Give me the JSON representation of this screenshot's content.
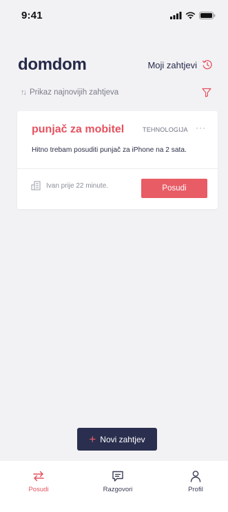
{
  "status_bar": {
    "time": "9:41"
  },
  "header": {
    "logo": "domdom",
    "my_requests_label": "Moji zahtjevi"
  },
  "sort": {
    "label": "Prikaz najnovijih zahtjeva",
    "arrows": "↑↓"
  },
  "requests": [
    {
      "title": "punjač za mobitel",
      "category": "TEHNOLOGIJA",
      "more": "···",
      "description": "Hitno trebam posuditi punjač za iPhone na 2 sata.",
      "author_text": "Ivan prije 22 minute.",
      "action_label": "Posudi"
    }
  ],
  "new_request": {
    "plus": "+",
    "label": "Novi zahtjev"
  },
  "tabs": [
    {
      "label": "Posudi",
      "icon": "swap-arrows-icon",
      "active": true
    },
    {
      "label": "Razgovori",
      "icon": "chat-bubble-icon",
      "active": false
    },
    {
      "label": "Profil",
      "icon": "user-icon",
      "active": false
    }
  ],
  "colors": {
    "accent": "#e85c66",
    "dark": "#2b2f4f",
    "background": "#f2f2f4"
  }
}
